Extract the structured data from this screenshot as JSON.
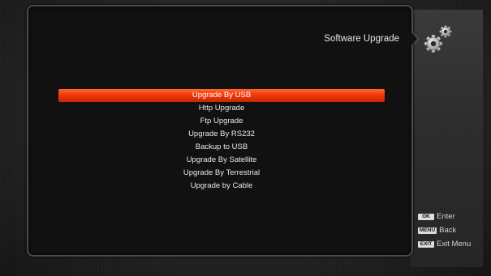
{
  "header": {
    "title": "Software Upgrade",
    "icon": "gears-icon"
  },
  "menu": {
    "selected_index": 0,
    "items": [
      {
        "label": "Upgrade By USB"
      },
      {
        "label": "Http Upgrade"
      },
      {
        "label": "Ftp Upgrade"
      },
      {
        "label": "Upgrade By RS232"
      },
      {
        "label": "Backup to USB"
      },
      {
        "label": "Upgrade By Satellite"
      },
      {
        "label": "Upgrade By Terrestrial"
      },
      {
        "label": "Upgrade by Cable"
      }
    ]
  },
  "legend": [
    {
      "key": "OK",
      "label": "Enter"
    },
    {
      "key": "MENU",
      "label": "Back"
    },
    {
      "key": "EXIT",
      "label": "Exit Menu"
    }
  ],
  "colors": {
    "highlight": "#f2380c",
    "panel": "#111111",
    "text": "#e8e8e8"
  }
}
